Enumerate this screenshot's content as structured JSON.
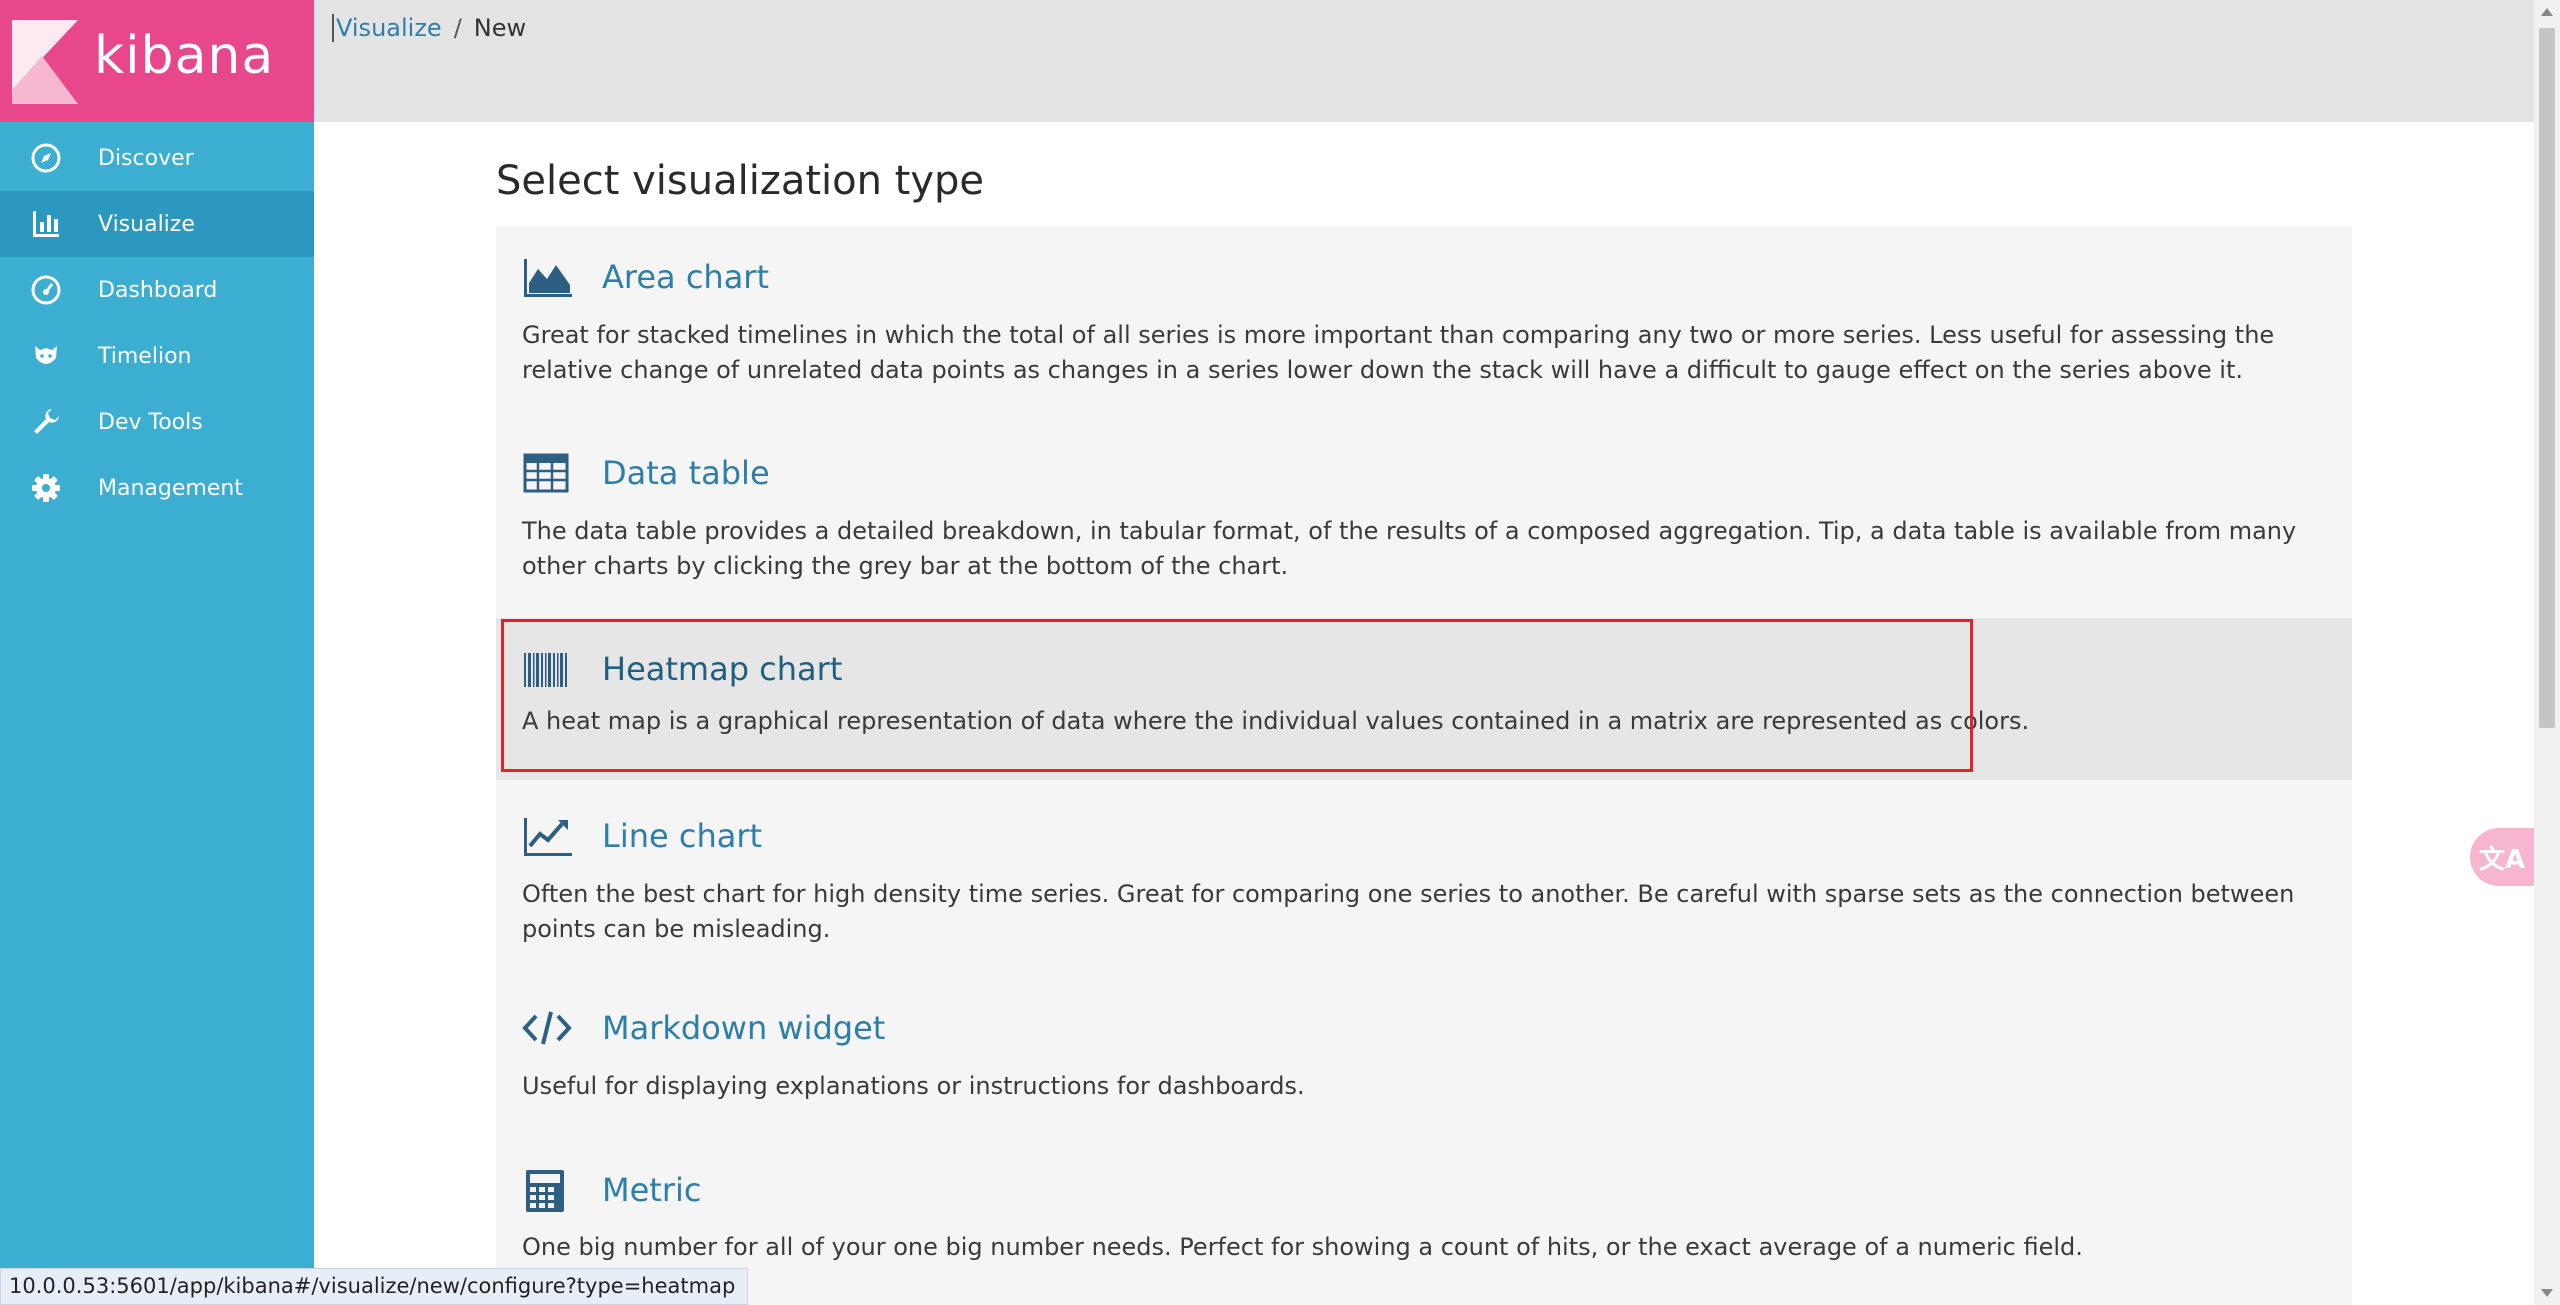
{
  "app": {
    "logo_text": "kibana"
  },
  "sidebar": {
    "items": [
      {
        "label": "Discover",
        "icon": "compass-icon"
      },
      {
        "label": "Visualize",
        "icon": "bar-chart-icon",
        "active": true
      },
      {
        "label": "Dashboard",
        "icon": "dashboard-icon"
      },
      {
        "label": "Timelion",
        "icon": "timelion-icon"
      },
      {
        "label": "Dev Tools",
        "icon": "wrench-icon"
      },
      {
        "label": "Management",
        "icon": "gear-icon"
      }
    ]
  },
  "breadcrumb": {
    "link": "Visualize",
    "separator": "/",
    "current": "New"
  },
  "main": {
    "title": "Select visualization type",
    "types": [
      {
        "name": "Area chart",
        "icon": "area-chart-icon",
        "desc": "Great for stacked timelines in which the total of all series is more important than comparing any two or more series. Less useful for assessing the relative change of unrelated data points as changes in a series lower down the stack will have a difficult to gauge effect on the series above it."
      },
      {
        "name": "Data table",
        "icon": "table-icon",
        "desc": "The data table provides a detailed breakdown, in tabular format, of the results of a composed aggregation. Tip, a data table is available from many other charts by clicking the grey bar at the bottom of the chart."
      },
      {
        "name": "Heatmap chart",
        "icon": "barcode-icon",
        "desc": "A heat map is a graphical representation of data where the individual values contained in a matrix are represented as colors."
      },
      {
        "name": "Line chart",
        "icon": "line-chart-icon",
        "desc": "Often the best chart for high density time series. Great for comparing one series to another. Be careful with sparse sets as the connection between points can be misleading."
      },
      {
        "name": "Markdown widget",
        "icon": "code-icon",
        "desc": "Useful for displaying explanations or instructions for dashboards."
      },
      {
        "name": "Metric",
        "icon": "calculator-icon",
        "desc": "One big number for all of your one big number needs. Perfect for showing a count of hits, or the exact average of a numeric field."
      }
    ]
  },
  "float_button": {
    "label": "文A",
    "icon": "translate-icon"
  },
  "statusbar": {
    "url": "10.0.0.53:5601/app/kibana#/visualize/new/configure?type=heatmap"
  },
  "colors": {
    "sidebar": "#3caed2",
    "sidebar_active": "#2d98bf",
    "logo_bg": "#e8488b",
    "link": "#2d7fa8",
    "highlight_border": "#e8202a"
  }
}
